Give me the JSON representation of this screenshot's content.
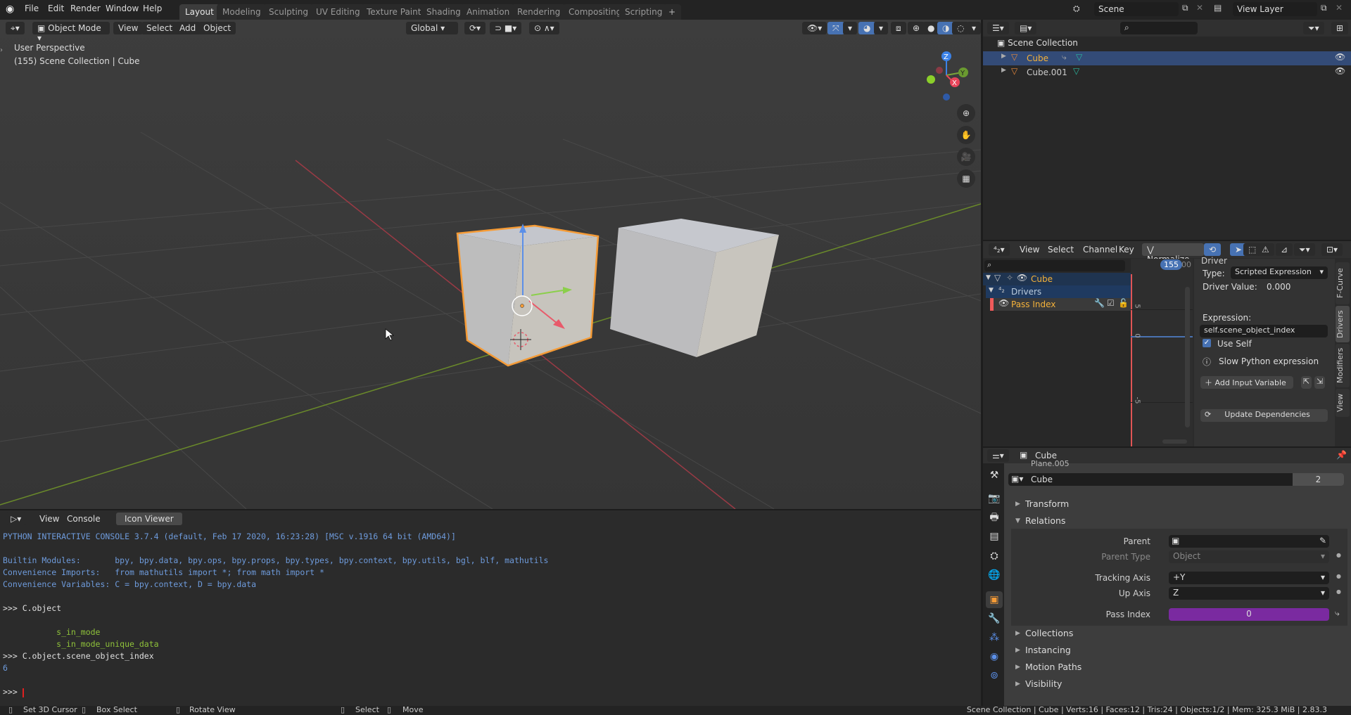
{
  "topbar": {
    "menus": [
      "File",
      "Edit",
      "Render",
      "Window",
      "Help"
    ],
    "workspaces": [
      "Layout",
      "Modeling",
      "Sculpting",
      "UV Editing",
      "Texture Paint",
      "Shading",
      "Animation",
      "Rendering",
      "Compositing",
      "Scripting"
    ],
    "active_workspace": "Layout",
    "add_tab": "+",
    "scene": "Scene",
    "view_layer": "View Layer"
  },
  "viewport": {
    "mode": "Object Mode",
    "menus": [
      "View",
      "Select",
      "Add",
      "Object"
    ],
    "orientation": "Global",
    "overlay_title": "User Perspective",
    "overlay_subtitle": "(155) Scene Collection | Cube",
    "gizmo_axes": {
      "x": "X",
      "y": "Y",
      "z": "Z"
    },
    "colors": {
      "x": "#e8445a",
      "y": "#7aa53a",
      "z": "#3b82e8",
      "selection": "#f59b36"
    }
  },
  "console": {
    "menus": [
      "View",
      "Console"
    ],
    "active_tab": "Icon Viewer",
    "lines": [
      {
        "text": "PYTHON INTERACTIVE CONSOLE 3.7.4 (default, Feb 17 2020, 16:23:28) [MSC v.1916 64 bit (AMD64)]",
        "cls": "c-blue"
      },
      {
        "text": "",
        "cls": "c-blue"
      },
      {
        "text": "Builtin Modules:       bpy, bpy.data, bpy.ops, bpy.props, bpy.types, bpy.context, bpy.utils, bgl, blf, mathutils",
        "cls": "c-blue"
      },
      {
        "text": "Convenience Imports:   from mathutils import *; from math import *",
        "cls": "c-blue"
      },
      {
        "text": "Convenience Variables: C = bpy.context, D = bpy.data",
        "cls": "c-blue"
      },
      {
        "text": "",
        "cls": "c-blue"
      },
      {
        "text": ">>> C.object",
        "cls": "c-white"
      },
      {
        "text": "",
        "cls": "c-white"
      },
      {
        "text": "           s_in_mode",
        "cls": "c-green"
      },
      {
        "text": "           s_in_mode_unique_data",
        "cls": "c-green"
      },
      {
        "text": ">>> C.object.scene_object_index",
        "cls": "c-white"
      },
      {
        "text": "6",
        "cls": "c-blue"
      },
      {
        "text": "",
        "cls": "c-white"
      },
      {
        "text": ">>> ",
        "cls": "c-white"
      }
    ]
  },
  "statusbar": {
    "hints": [
      "Set 3D Cursor",
      "Box Select",
      "Rotate View",
      "Select",
      "Move"
    ],
    "stats": "Scene Collection | Cube | Verts:16 | Faces:12 | Tris:24 | Objects:1/2 | Mem: 325.3 MiB | 2.83.3"
  },
  "outliner": {
    "root": "Scene Collection",
    "items": [
      {
        "name": "Cube",
        "selected": true
      },
      {
        "name": "Cube.001",
        "selected": false
      }
    ],
    "search_placeholder": ""
  },
  "drivers_editor": {
    "menus": [
      "View",
      "Select",
      "Channel",
      "Key"
    ],
    "normalize": "Normalize",
    "current_frame": "155",
    "frame_tail": "00",
    "channels": [
      {
        "name": "Cube",
        "level": 0
      },
      {
        "name": "Drivers",
        "level": 1
      },
      {
        "name": "Pass Index",
        "level": 2
      }
    ],
    "y_ticks": [
      "5",
      "0",
      "-5"
    ],
    "sidebar": {
      "section": "Driver",
      "type_label": "Type:",
      "type_value": "Scripted Expression",
      "driver_value_label": "Driver Value:",
      "driver_value": "0.000",
      "expression_label": "Expression:",
      "expression": "self.scene_object_index",
      "use_self_label": "Use Self",
      "use_self": true,
      "warning": "Slow Python expression",
      "add_variable": "Add Input Variable",
      "update_deps": "Update Dependencies",
      "tabs": [
        "F-Curve",
        "Drivers",
        "Modifiers",
        "View"
      ],
      "active_tab": "Drivers"
    }
  },
  "properties": {
    "header_object": "Cube",
    "partial_text": "Plane.005",
    "datablock_name": "Cube",
    "datablock_users": "2",
    "panels": {
      "transform": "Transform",
      "relations": "Relations",
      "collections": "Collections",
      "instancing": "Instancing",
      "motion_paths": "Motion Paths",
      "visibility": "Visibility"
    },
    "fields": {
      "parent_label": "Parent",
      "parent_value": "",
      "parent_type_label": "Parent Type",
      "parent_type_value": "Object",
      "tracking_axis_label": "Tracking Axis",
      "tracking_axis_value": "+Y",
      "up_axis_label": "Up Axis",
      "up_axis_value": "Z",
      "pass_index_label": "Pass Index",
      "pass_index_value": "0"
    },
    "driven_color": "#7a2aa0"
  }
}
